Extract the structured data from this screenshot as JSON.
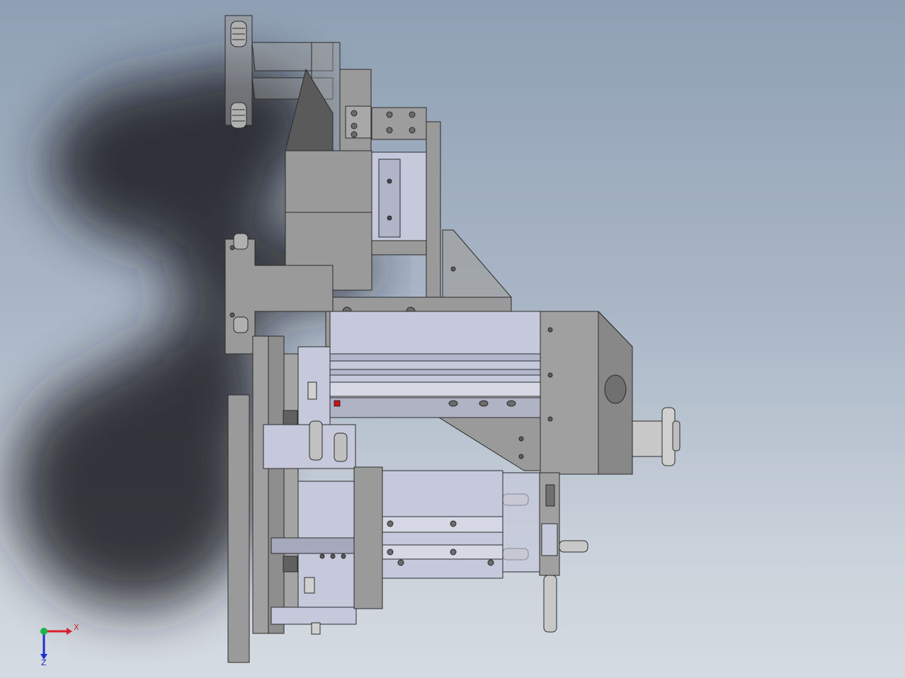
{
  "view": {
    "background_top": "#8fa0b4",
    "background_bottom": "#d5dbe2",
    "part_color": "#9a9a9a",
    "slide_color": "#c6c8dc",
    "edge_color": "#2b2b2b",
    "accent_color": "#d0101a"
  },
  "triad": {
    "x_label": "X",
    "z_label": "Z",
    "x_color": "#d8202a",
    "y_color": "#19b44a",
    "z_color": "#1c2fd0"
  }
}
